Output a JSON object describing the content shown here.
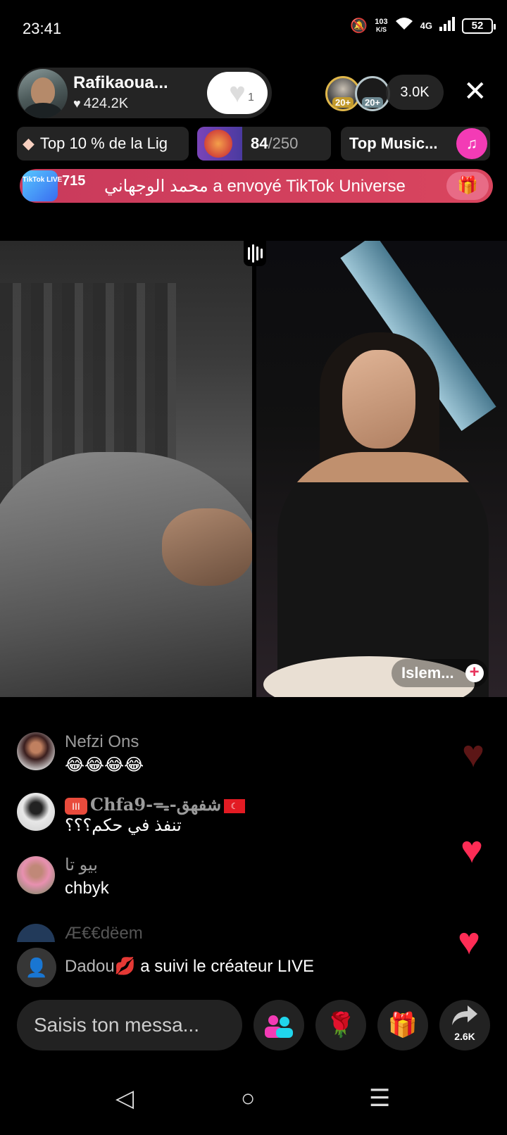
{
  "status_bar": {
    "time": "23:41",
    "speed_value": "103",
    "speed_unit": "K/S",
    "network": "4G",
    "battery": "52"
  },
  "host": {
    "name": "Rafikaoua...",
    "likes": "424.2K",
    "follow_count": "1"
  },
  "viewers": {
    "badge1": "20+",
    "badge2": "20+",
    "count": "3.0K"
  },
  "chips": {
    "league": "Top 10 % de la Lig",
    "progress_current": "84",
    "progress_total": "/250",
    "progress_fraction": 0.336,
    "music": "Top Music..."
  },
  "gift_banner": {
    "icon_text": "TikTok LIVE",
    "number": "715",
    "text": "محمد الوجهاني a envoyé TikTok Universe"
  },
  "guest": {
    "name": "Islem..."
  },
  "comments": [
    {
      "name": "Nefzi Ons",
      "text": "😂😂😂😂"
    },
    {
      "name": "Chfa9-ᯓ-شفهق",
      "badge": "III",
      "text": "تنفذ في حكم؟؟؟"
    },
    {
      "name": "بيو تا",
      "text": "chbyk"
    },
    {
      "name": "Æ€€dëem",
      "text": ""
    }
  ],
  "notice": {
    "user": "Dadou💋",
    "text": " a suivi le créateur LIVE"
  },
  "bottom": {
    "input_placeholder": "Saisis ton messa...",
    "share_count": "2.6K"
  },
  "colors": {
    "accent_pink": "#f33bb5",
    "banner_red": "#d9455e",
    "heart_red": "#fe2c55"
  }
}
